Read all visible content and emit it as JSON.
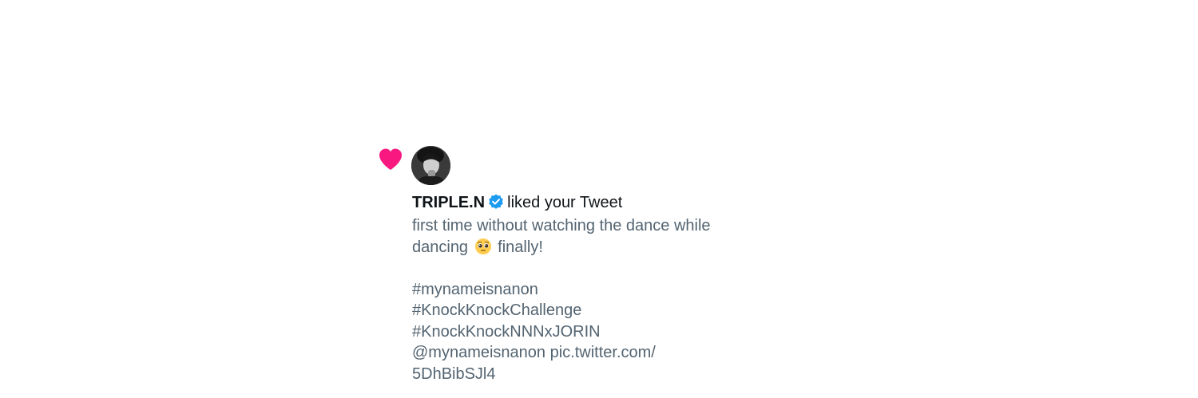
{
  "notification": {
    "icon": "heart-icon",
    "icon_color": "#f91880",
    "avatar": "avatar",
    "user_name": "TRIPLE.N",
    "verified_icon": "verified-badge-icon",
    "verified_color": "#1d9bf0",
    "action_text": "liked your Tweet",
    "tweet": {
      "line1": "first time without watching the dance while",
      "line2_before_emoji": "dancing",
      "emoji": "pleading-face-emoji",
      "line2_after_emoji": "finally!",
      "hashtag1": "#mynameisnanon",
      "hashtag2": "#KnockKnockChallenge",
      "hashtag3": "#KnockKnockNNNxJORIN",
      "mention_line": "@mynameisnanon pic.twitter.com/",
      "link_end": "5DhBibSJl4"
    }
  }
}
